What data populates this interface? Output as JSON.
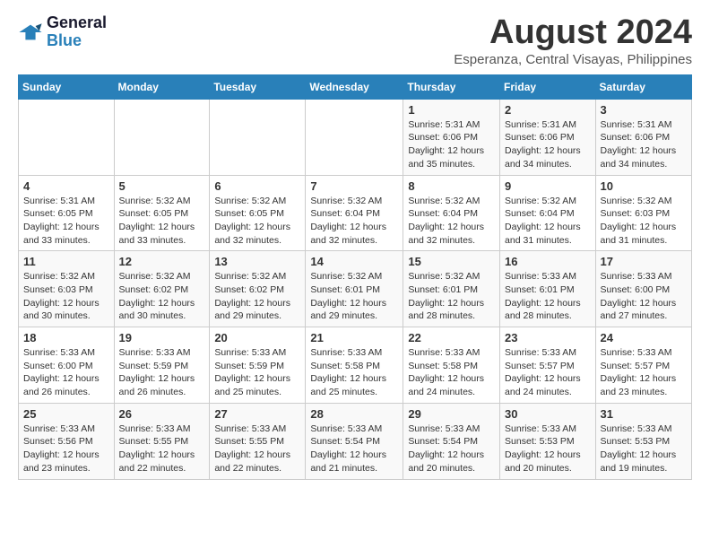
{
  "logo": {
    "line1": "General",
    "line2": "Blue"
  },
  "title": "August 2024",
  "subtitle": "Esperanza, Central Visayas, Philippines",
  "weekdays": [
    "Sunday",
    "Monday",
    "Tuesday",
    "Wednesday",
    "Thursday",
    "Friday",
    "Saturday"
  ],
  "weeks": [
    [
      {
        "day": "",
        "info": ""
      },
      {
        "day": "",
        "info": ""
      },
      {
        "day": "",
        "info": ""
      },
      {
        "day": "",
        "info": ""
      },
      {
        "day": "1",
        "info": "Sunrise: 5:31 AM\nSunset: 6:06 PM\nDaylight: 12 hours\nand 35 minutes."
      },
      {
        "day": "2",
        "info": "Sunrise: 5:31 AM\nSunset: 6:06 PM\nDaylight: 12 hours\nand 34 minutes."
      },
      {
        "day": "3",
        "info": "Sunrise: 5:31 AM\nSunset: 6:06 PM\nDaylight: 12 hours\nand 34 minutes."
      }
    ],
    [
      {
        "day": "4",
        "info": "Sunrise: 5:31 AM\nSunset: 6:05 PM\nDaylight: 12 hours\nand 33 minutes."
      },
      {
        "day": "5",
        "info": "Sunrise: 5:32 AM\nSunset: 6:05 PM\nDaylight: 12 hours\nand 33 minutes."
      },
      {
        "day": "6",
        "info": "Sunrise: 5:32 AM\nSunset: 6:05 PM\nDaylight: 12 hours\nand 32 minutes."
      },
      {
        "day": "7",
        "info": "Sunrise: 5:32 AM\nSunset: 6:04 PM\nDaylight: 12 hours\nand 32 minutes."
      },
      {
        "day": "8",
        "info": "Sunrise: 5:32 AM\nSunset: 6:04 PM\nDaylight: 12 hours\nand 32 minutes."
      },
      {
        "day": "9",
        "info": "Sunrise: 5:32 AM\nSunset: 6:04 PM\nDaylight: 12 hours\nand 31 minutes."
      },
      {
        "day": "10",
        "info": "Sunrise: 5:32 AM\nSunset: 6:03 PM\nDaylight: 12 hours\nand 31 minutes."
      }
    ],
    [
      {
        "day": "11",
        "info": "Sunrise: 5:32 AM\nSunset: 6:03 PM\nDaylight: 12 hours\nand 30 minutes."
      },
      {
        "day": "12",
        "info": "Sunrise: 5:32 AM\nSunset: 6:02 PM\nDaylight: 12 hours\nand 30 minutes."
      },
      {
        "day": "13",
        "info": "Sunrise: 5:32 AM\nSunset: 6:02 PM\nDaylight: 12 hours\nand 29 minutes."
      },
      {
        "day": "14",
        "info": "Sunrise: 5:32 AM\nSunset: 6:01 PM\nDaylight: 12 hours\nand 29 minutes."
      },
      {
        "day": "15",
        "info": "Sunrise: 5:32 AM\nSunset: 6:01 PM\nDaylight: 12 hours\nand 28 minutes."
      },
      {
        "day": "16",
        "info": "Sunrise: 5:33 AM\nSunset: 6:01 PM\nDaylight: 12 hours\nand 28 minutes."
      },
      {
        "day": "17",
        "info": "Sunrise: 5:33 AM\nSunset: 6:00 PM\nDaylight: 12 hours\nand 27 minutes."
      }
    ],
    [
      {
        "day": "18",
        "info": "Sunrise: 5:33 AM\nSunset: 6:00 PM\nDaylight: 12 hours\nand 26 minutes."
      },
      {
        "day": "19",
        "info": "Sunrise: 5:33 AM\nSunset: 5:59 PM\nDaylight: 12 hours\nand 26 minutes."
      },
      {
        "day": "20",
        "info": "Sunrise: 5:33 AM\nSunset: 5:59 PM\nDaylight: 12 hours\nand 25 minutes."
      },
      {
        "day": "21",
        "info": "Sunrise: 5:33 AM\nSunset: 5:58 PM\nDaylight: 12 hours\nand 25 minutes."
      },
      {
        "day": "22",
        "info": "Sunrise: 5:33 AM\nSunset: 5:58 PM\nDaylight: 12 hours\nand 24 minutes."
      },
      {
        "day": "23",
        "info": "Sunrise: 5:33 AM\nSunset: 5:57 PM\nDaylight: 12 hours\nand 24 minutes."
      },
      {
        "day": "24",
        "info": "Sunrise: 5:33 AM\nSunset: 5:57 PM\nDaylight: 12 hours\nand 23 minutes."
      }
    ],
    [
      {
        "day": "25",
        "info": "Sunrise: 5:33 AM\nSunset: 5:56 PM\nDaylight: 12 hours\nand 23 minutes."
      },
      {
        "day": "26",
        "info": "Sunrise: 5:33 AM\nSunset: 5:55 PM\nDaylight: 12 hours\nand 22 minutes."
      },
      {
        "day": "27",
        "info": "Sunrise: 5:33 AM\nSunset: 5:55 PM\nDaylight: 12 hours\nand 22 minutes."
      },
      {
        "day": "28",
        "info": "Sunrise: 5:33 AM\nSunset: 5:54 PM\nDaylight: 12 hours\nand 21 minutes."
      },
      {
        "day": "29",
        "info": "Sunrise: 5:33 AM\nSunset: 5:54 PM\nDaylight: 12 hours\nand 20 minutes."
      },
      {
        "day": "30",
        "info": "Sunrise: 5:33 AM\nSunset: 5:53 PM\nDaylight: 12 hours\nand 20 minutes."
      },
      {
        "day": "31",
        "info": "Sunrise: 5:33 AM\nSunset: 5:53 PM\nDaylight: 12 hours\nand 19 minutes."
      }
    ]
  ]
}
